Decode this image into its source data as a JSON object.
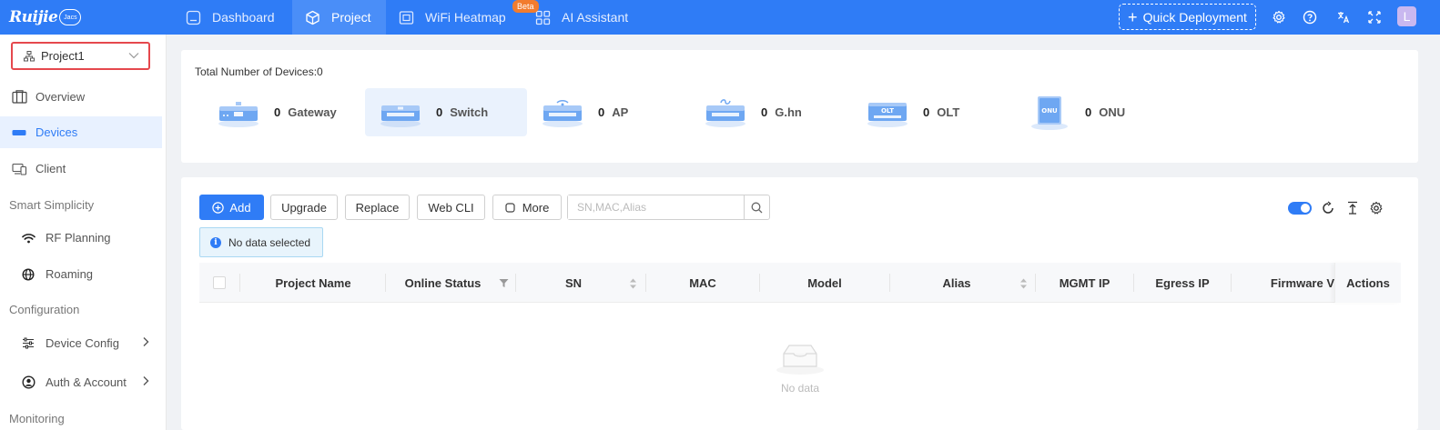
{
  "app": {
    "logo_text": "Ruijie",
    "logo_badge": "Jacs"
  },
  "nav": {
    "items": [
      {
        "label": "Dashboard",
        "icon": "dashboard-icon"
      },
      {
        "label": "Project",
        "icon": "cube-icon",
        "active": true
      },
      {
        "label": "WiFi Heatmap",
        "icon": "heatmap-icon",
        "badge": "Beta"
      },
      {
        "label": "AI Assistant",
        "icon": "grid-icon"
      }
    ],
    "quick_deploy": "Quick Deployment",
    "avatar_letter": "L"
  },
  "sidebar": {
    "project": "Project1",
    "items": [
      {
        "label": "Overview",
        "icon": "overview-icon"
      },
      {
        "label": "Devices",
        "icon": "devices-icon",
        "active": true
      },
      {
        "label": "Client",
        "icon": "client-icon"
      }
    ],
    "section_smart": "Smart Simplicity",
    "smart_items": [
      {
        "label": "RF Planning",
        "icon": "wifi-icon"
      },
      {
        "label": "Roaming",
        "icon": "globe-icon"
      }
    ],
    "section_config": "Configuration",
    "config_items": [
      {
        "label": "Device Config",
        "icon": "sliders-icon"
      },
      {
        "label": "Auth & Account",
        "icon": "user-circle-icon"
      }
    ],
    "section_monitoring": "Monitoring"
  },
  "summary": {
    "total_label": "Total Number of Devices:0",
    "devices": [
      {
        "count": "0",
        "label": "Gateway"
      },
      {
        "count": "0",
        "label": "Switch",
        "active": true
      },
      {
        "count": "0",
        "label": "AP"
      },
      {
        "count": "0",
        "label": "G.hn"
      },
      {
        "count": "0",
        "label": "OLT"
      },
      {
        "count": "0",
        "label": "ONU"
      }
    ]
  },
  "toolbar": {
    "add": "Add",
    "upgrade": "Upgrade",
    "replace": "Replace",
    "webcli": "Web CLI",
    "more": "More",
    "search_placeholder": "SN,MAC,Alias",
    "selection_info": "No data selected"
  },
  "table": {
    "columns": [
      "Project Name",
      "Online Status",
      "SN",
      "MAC",
      "Model",
      "Alias",
      "MGMT IP",
      "Egress IP",
      "Firmware V"
    ],
    "actions": "Actions",
    "empty": "No data"
  },
  "colors": {
    "primary": "#2f7cf6",
    "beta": "#f27c2e",
    "highlight_border": "#e5484d"
  }
}
